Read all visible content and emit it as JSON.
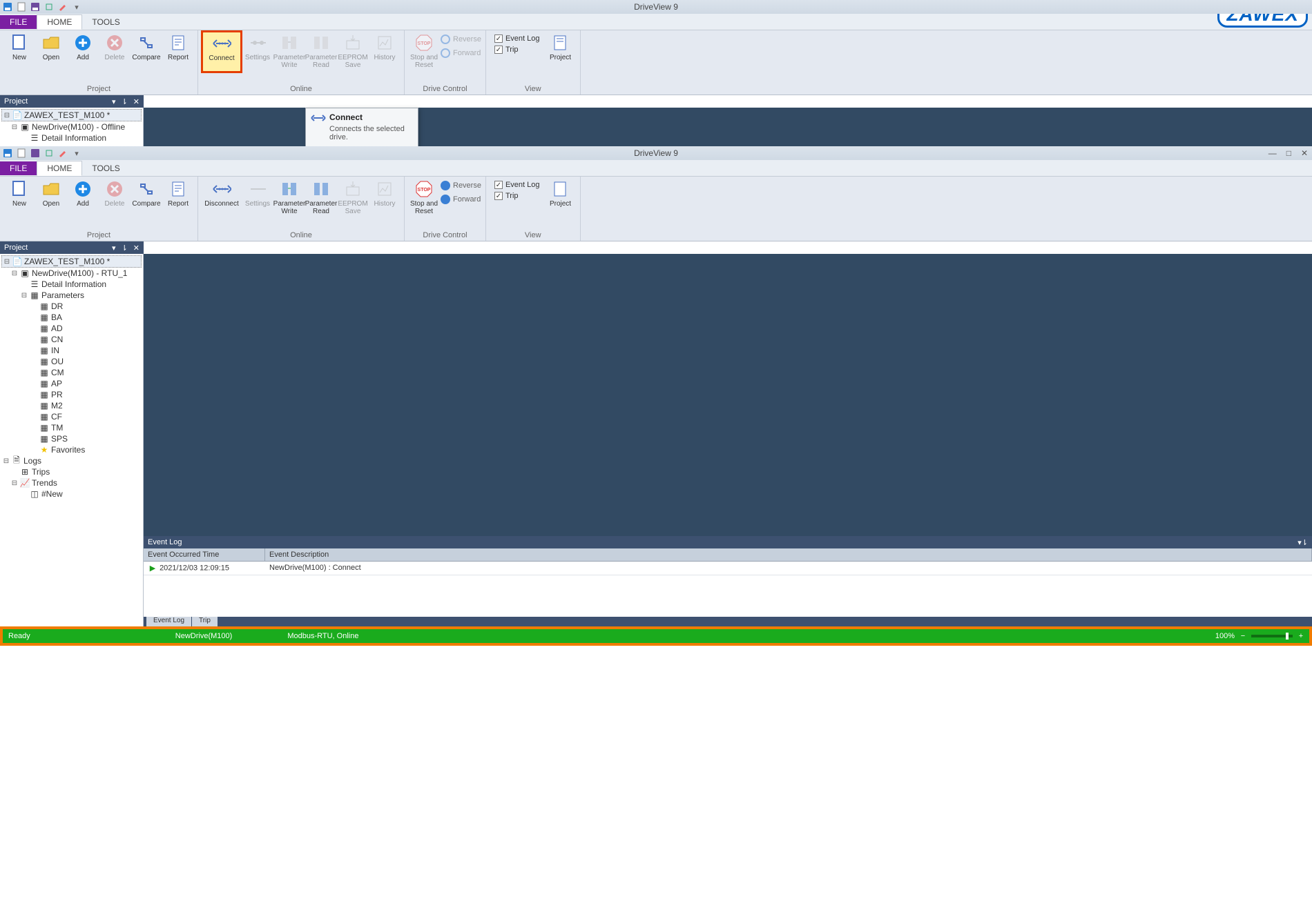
{
  "app_title": "DriveView 9",
  "logo_text": "ZAWEX",
  "tabs": {
    "file": "FILE",
    "home": "HOME",
    "tools": "TOOLS"
  },
  "ribbon_groups": {
    "project": "Project",
    "online": "Online",
    "drive_control": "Drive Control",
    "view": "View"
  },
  "ribbon_top": {
    "new": "New",
    "open": "Open",
    "add": "Add",
    "delete": "Delete",
    "compare": "Compare",
    "report": "Report",
    "connect": "Connect",
    "settings": "Settings",
    "pwrite": "Parameter Write",
    "pread": "Parameter Read",
    "eeprom": "EEPROM Save",
    "history": "History",
    "stop": "Stop and Reset",
    "reverse": "Reverse",
    "forward": "Forward",
    "eventlog": "Event Log",
    "trip": "Trip",
    "project_btn": "Project"
  },
  "ribbon_bottom": {
    "new": "New",
    "open": "Open",
    "add": "Add",
    "delete": "Delete",
    "compare": "Compare",
    "report": "Report",
    "disconnect": "Disconnect",
    "settings": "Settings",
    "pwrite": "Parameter Write",
    "pread": "Parameter Read",
    "eeprom": "EEPROM Save",
    "history": "History",
    "stop": "Stop and Reset",
    "reverse": "Reverse",
    "forward": "Forward",
    "eventlog": "Event Log",
    "trip": "Trip",
    "project_btn": "Project"
  },
  "tooltip": {
    "title": "Connect",
    "body": "Connects the selected drive."
  },
  "project_panel_title": "Project",
  "tree_top": {
    "root": "ZAWEX_TEST_M100 *",
    "drive": "NewDrive(M100) - Offline",
    "detail": "Detail Information"
  },
  "tree_bottom": {
    "root": "ZAWEX_TEST_M100 *",
    "drive": "NewDrive(M100) - RTU_1",
    "detail": "Detail Information",
    "parameters": "Parameters",
    "param_groups": [
      "DR",
      "BA",
      "AD",
      "CN",
      "IN",
      "OU",
      "CM",
      "AP",
      "PR",
      "M2",
      "CF",
      "TM",
      "SPS"
    ],
    "favorites": "Favorites",
    "logs": "Logs",
    "trips": "Trips",
    "trends": "Trends",
    "new_trend": "#New"
  },
  "eventlog": {
    "title": "Event Log",
    "col_time": "Event Occurred Time",
    "col_desc": "Event Description",
    "rows": [
      {
        "time": "2021/12/03 12:09:15",
        "desc": "NewDrive(M100) : Connect"
      }
    ],
    "tabs": {
      "eventlog": "Event Log",
      "trip": "Trip"
    }
  },
  "status": {
    "ready": "Ready",
    "drive": "NewDrive(M100)",
    "conn": "Modbus-RTU, Online",
    "zoom": "100%"
  }
}
